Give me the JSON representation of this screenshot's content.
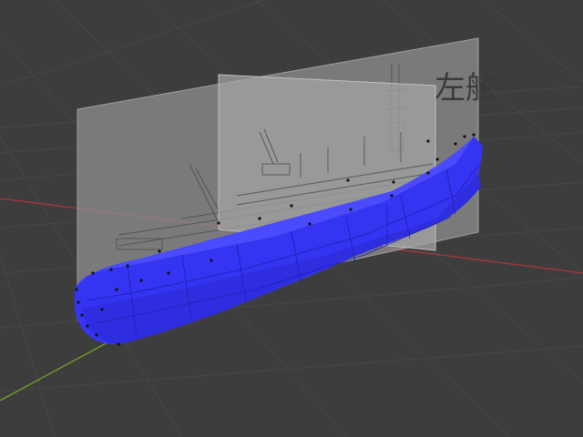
{
  "app": "3D viewport",
  "reference_images": {
    "side_label": "左舷"
  },
  "mesh": {
    "name": "ship-hull",
    "color": "#3333ff"
  },
  "axes": {
    "x_color": "#9a3a3a",
    "y_color": "#6a9a2a"
  },
  "grid_color": "#474747",
  "background_color": "#3d3d3d"
}
